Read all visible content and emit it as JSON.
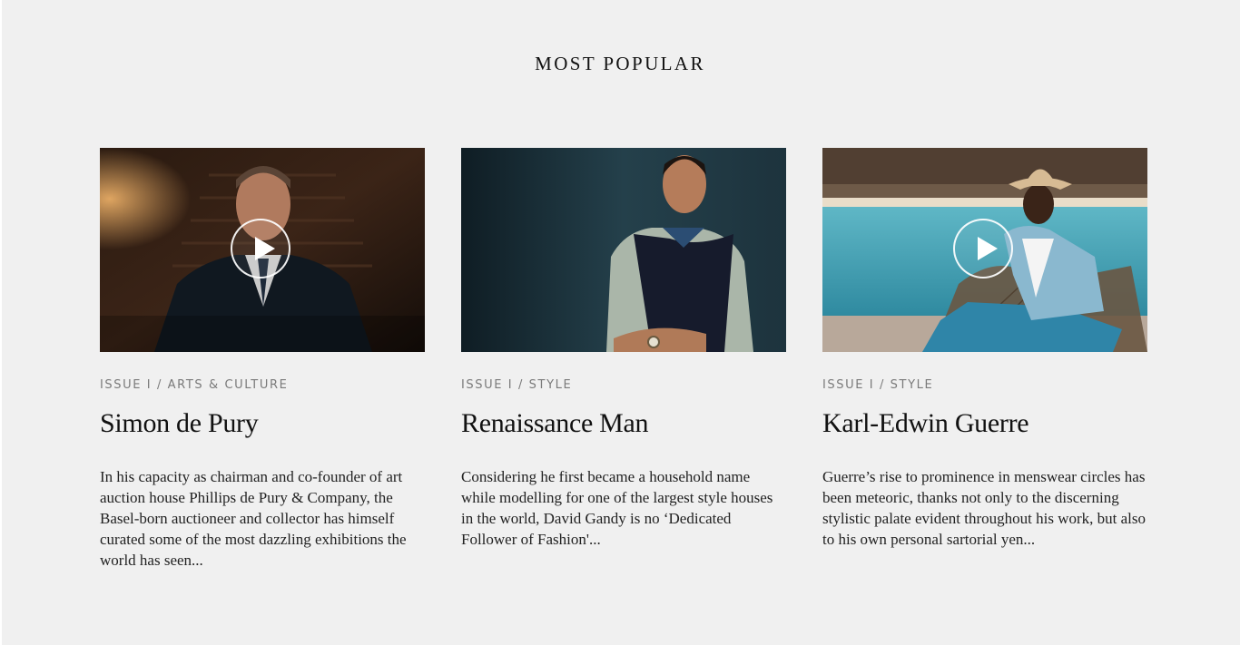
{
  "section": {
    "title": "MOST POPULAR"
  },
  "cards": [
    {
      "category": "ISSUE I / ARTS & CULTURE",
      "title": "Simon de Pury",
      "excerpt": "In his capacity as chairman and co-founder of art auction house Phillips de Pury & Company, the Basel-born auctioneer and collector has himself curated some of the most dazzling exhibitions the world has seen...",
      "has_video": true
    },
    {
      "category": "ISSUE I / STYLE",
      "title": "Renaissance Man",
      "excerpt": "Considering he first became a household name while modelling for one of the largest style houses in the world, David Gandy is no ‘Dedicated Follower of Fashion'...",
      "has_video": false
    },
    {
      "category": "ISSUE I / STYLE",
      "title": "Karl-Edwin Guerre",
      "excerpt": "Guerre’s rise to prominence in menswear circles has been meteoric, thanks not only to the discerning stylistic palate evident throughout his work, but also to his own personal sartorial yen...",
      "has_video": true
    }
  ],
  "icons": {
    "play": "play-icon"
  },
  "colors": {
    "background": "#f0f0f0",
    "category": "#7a7a7a",
    "text": "#111111"
  }
}
